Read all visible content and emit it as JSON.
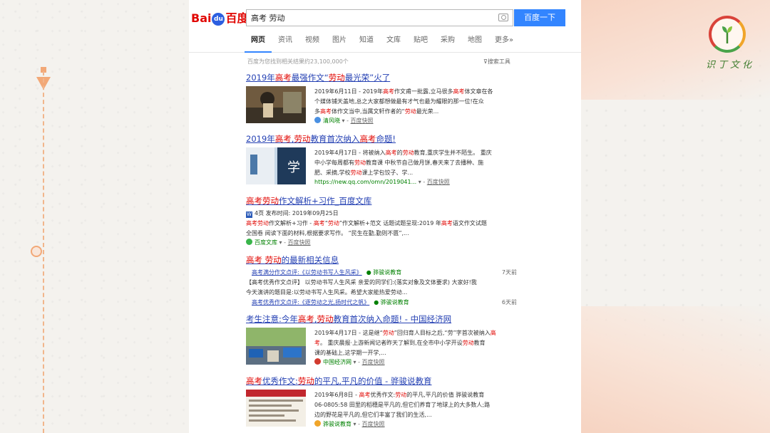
{
  "brand": {
    "logo_text_left": "Bai",
    "logo_paw": "du",
    "logo_text_right": "百度"
  },
  "search": {
    "query": "高考 劳动",
    "button_label": "百度一下"
  },
  "tabs": [
    "网页",
    "资讯",
    "视频",
    "图片",
    "知道",
    "文库",
    "贴吧",
    "采购",
    "地图",
    "更多»"
  ],
  "result_count": "百度为您找到相关结果约23,100,000个",
  "tools_label": "搜索工具",
  "results": [
    {
      "title_parts": [
        [
          "2019年",
          false
        ],
        [
          "高考",
          true
        ],
        [
          "最强作文“",
          false
        ],
        [
          "劳动",
          true
        ],
        [
          "最光荣”火了",
          false
        ]
      ],
      "abstract_lines": [
        [
          [
            "2019年6月11日 - 2019年",
            false
          ],
          [
            "高考",
            true
          ],
          [
            "作文甫一批露,立马很多",
            false
          ],
          [
            "高考",
            true
          ],
          [
            "体文章在各",
            false
          ]
        ],
        [
          [
            "个媒体铺天盖地,总之大家都想做最有才气也最为耀眼的那一位!在众",
            false
          ]
        ],
        [
          [
            "多",
            false
          ],
          [
            "高考",
            true
          ],
          [
            "体作文当中,当属文轩作者的“",
            false
          ],
          [
            "劳动",
            true
          ],
          [
            "最光荣...",
            false
          ]
        ]
      ],
      "source": "清风晓",
      "snapshot": "百度快照"
    },
    {
      "title_parts": [
        [
          "2019年",
          false
        ],
        [
          "高考",
          true
        ],
        [
          ",",
          false
        ],
        [
          "劳动",
          true
        ],
        [
          "教育首次纳入",
          false
        ],
        [
          "高考",
          true
        ],
        [
          "命题!",
          false
        ]
      ],
      "abstract_lines": [
        [
          [
            "2019年4月17日 - 将被纳入",
            false
          ],
          [
            "高考",
            true
          ],
          [
            "的",
            false
          ],
          [
            "劳动",
            true
          ],
          [
            "教育,重庆学生并不陌生。 重庆",
            false
          ]
        ],
        [
          [
            "中小学每周都有",
            false
          ],
          [
            "劳动",
            true
          ],
          [
            "教育课 中秋节自己做月饼,春天来了去播种、施",
            false
          ]
        ],
        [
          [
            "肥、采摘,学校",
            false
          ],
          [
            "劳动",
            true
          ],
          [
            "课上学包饺子、学...",
            false
          ]
        ]
      ],
      "source": "https://new.qq.com/omn/2019041...",
      "snapshot": "百度快照"
    },
    {
      "title_parts": [
        [
          "高考",
          true
        ],
        [
          "劳动",
          true
        ],
        [
          "作文解析+习作_百度文库",
          false
        ]
      ],
      "meta": "4页 发布时间: 2019年09月25日",
      "abstract_lines": [
        [
          [
            "高考",
            true
          ],
          [
            "劳动",
            true
          ],
          [
            "作文解析+习作 - ",
            false
          ],
          [
            "高考",
            true
          ],
          [
            "“",
            false
          ],
          [
            "劳动",
            true
          ],
          [
            "”作文解析+范文 话题试题呈现:2019 年",
            false
          ],
          [
            "高考",
            true
          ],
          [
            "语文作文试题",
            false
          ]
        ],
        [
          [
            "全国卷 阅读下面的材料,根据要求写作。 “民生在勤,勤则不匮”,...",
            false
          ]
        ]
      ],
      "source": "百度文库",
      "snapshot": "百度快照"
    },
    {
      "title_parts": [
        [
          "高考",
          true
        ],
        [
          " ",
          false
        ],
        [
          "劳动",
          true
        ],
        [
          "的最新相关信息",
          false
        ]
      ],
      "news": [
        {
          "link_parts": [
            [
              "高考",
              true
            ],
            [
              "满分作文点评:《以",
              false
            ],
            [
              "劳动",
              true
            ],
            [
              "书写人生风采》",
              false
            ]
          ],
          "source": "骅骏说教育",
          "time": "7天前"
        },
        {
          "text_parts": [
            [
              "【",
              false
            ],
            [
              "高考",
              true
            ],
            [
              "优秀作文点评】 以",
              false
            ],
            [
              "劳动",
              true
            ],
            [
              "书写人生风采 亲爱的同学们:(落实对象及文体要求) 大家好!我",
              false
            ]
          ]
        },
        {
          "text_parts": [
            [
              "今天演讲的题目是:以",
              false
            ],
            [
              "劳动",
              true
            ],
            [
              "书写人生风采。希望大家能热爱",
              false
            ],
            [
              "劳动",
              true
            ],
            [
              "...",
              false
            ]
          ]
        },
        {
          "link_parts": [
            [
              "高考",
              true
            ],
            [
              "优秀作文点评:《逐",
              false
            ],
            [
              "劳动",
              true
            ],
            [
              "之光,扬时代之帆》",
              false
            ]
          ],
          "source": "骅骏说教育",
          "time": "6天前"
        }
      ]
    },
    {
      "title_parts": [
        [
          "考生注意:今年",
          false
        ],
        [
          "高考",
          true
        ],
        [
          ",",
          false
        ],
        [
          "劳动",
          true
        ],
        [
          "教育首次纳入命题! - 中国经济网",
          false
        ]
      ],
      "abstract_lines": [
        [
          [
            "2019年4月17日 - 这是继“",
            false
          ],
          [
            "劳动",
            true
          ],
          [
            "”回归育人目标之后,“劳”字首次被纳入",
            false
          ],
          [
            "高",
            true
          ]
        ],
        [
          [
            "考",
            true
          ],
          [
            "。 重庆晨报·上游新闻记者昨天了解到,在全市中小学开设",
            false
          ],
          [
            "劳动",
            true
          ],
          [
            "教育",
            false
          ]
        ],
        [
          [
            "课的基础上,这学期一开学,...",
            false
          ]
        ]
      ],
      "source": "中国经济网",
      "snapshot": "百度快照"
    },
    {
      "title_parts": [
        [
          "高考",
          true
        ],
        [
          "优秀作文:",
          false
        ],
        [
          "劳动",
          true
        ],
        [
          "的平凡,平凡的价值 - 骅骏说教育",
          false
        ]
      ],
      "abstract_lines": [
        [
          [
            "2019年6月8日 - ",
            false
          ],
          [
            "高考",
            true
          ],
          [
            "优秀作文:",
            false
          ],
          [
            "劳动",
            true
          ],
          [
            "的平凡,平凡的价值 骅骏说教育",
            false
          ]
        ],
        [
          [
            "06-0805:58 田里的稻穗是平凡的,但它们养育了地球上的大多数人;路",
            false
          ]
        ],
        [
          [
            "边的野花是平凡的,但它们丰富了我们的生活,...",
            false
          ]
        ]
      ],
      "source": "骅骏说教育",
      "snapshot": "百度快照"
    }
  ],
  "watermark_logo": "识丁文化",
  "colors": {
    "accent": "#3385ff",
    "link": "#2440b3",
    "highlight": "#e10602",
    "source": "#008000",
    "deco": "#f2a877"
  }
}
